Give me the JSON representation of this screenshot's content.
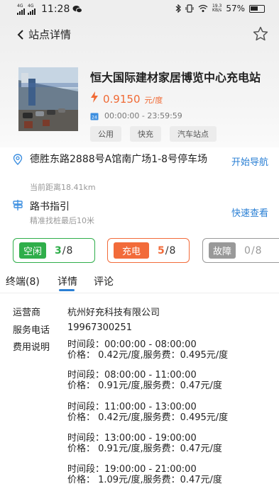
{
  "status_bar": {
    "network_1": "4G",
    "network_2": "4G",
    "time": "11:28",
    "net_speed_value": "19.3",
    "net_speed_unit": "KB/s",
    "battery": "57%"
  },
  "nav": {
    "title": "站点详情"
  },
  "station": {
    "name": "恒大国际建材家居博览中心充电站",
    "price": "0.9150",
    "price_unit": "元/度",
    "hours": "00:00:00 - 23:59:59",
    "tags": [
      "公用",
      "快充",
      "汽车站点"
    ]
  },
  "address": {
    "text": "德胜东路2888号A馆南广场1-8号停车场",
    "distance": "当前距离18.41km",
    "nav_label": "开始导航"
  },
  "guide": {
    "title": "路书指引",
    "subtitle": "精准找桩最后10米",
    "link_label": "快速查看"
  },
  "connectors": {
    "idle": {
      "label": "空闲",
      "count": "3",
      "total": "/8",
      "color": "#2fae4a"
    },
    "charging": {
      "label": "充电",
      "count": "5",
      "total": "/8",
      "color": "#f26b3a"
    },
    "fault": {
      "label": "故障",
      "count": "0",
      "total": "/8",
      "color": "#999999"
    }
  },
  "tabs": [
    "终端(8)",
    "详情",
    "评论"
  ],
  "details": {
    "operator_label": "运营商",
    "operator": "杭州好充科技有限公司",
    "phone_label": "服务电话",
    "phone": "19967300251",
    "fee_label": "费用说明",
    "fees": [
      {
        "period": "时间段：00:00:00 - 08:00:00",
        "price": "价格：  0.42元/度,服务费：0.495元/度"
      },
      {
        "period": "时间段：08:00:00 - 11:00:00",
        "price": "价格：  0.91元/度,服务费：0.47元/度"
      },
      {
        "period": "时间段：11:00:00 - 13:00:00",
        "price": "价格：  0.42元/度,服务费：0.495元/度"
      },
      {
        "period": "时间段：13:00:00 - 19:00:00",
        "price": "价格：  0.91元/度,服务费：0.47元/度"
      },
      {
        "period": "时间段：19:00:00 - 21:00:00",
        "price": "价格：  1.09元/度,服务费：0.47元/度"
      }
    ]
  },
  "colors": {
    "accent": "#2a7fd4",
    "price": "#f06a35"
  }
}
